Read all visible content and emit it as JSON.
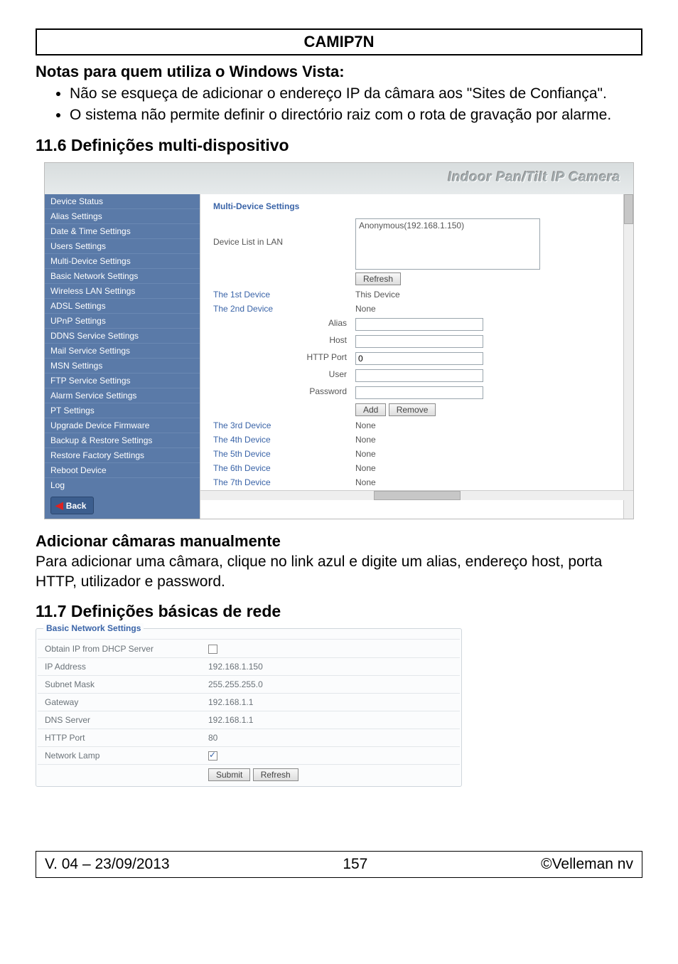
{
  "header": {
    "title": "CAMIP7N"
  },
  "notas": {
    "heading": "Notas para quem utiliza o Windows Vista:",
    "items": [
      "Não se esqueça de adicionar o endereço IP da câmara aos \"Sites de Confiança\".",
      "O sistema não permite definir o directório raiz com o rota de gravação por alarme."
    ]
  },
  "sec_multi": {
    "heading": "11.6   Definições multi-dispositivo",
    "brand": "Indoor Pan/Tilt IP Camera",
    "sidebar": [
      "Device Status",
      "Alias Settings",
      "Date & Time Settings",
      "Users Settings",
      "Multi-Device Settings",
      "Basic Network Settings",
      "Wireless LAN Settings",
      "ADSL Settings",
      "UPnP Settings",
      "DDNS Service Settings",
      "Mail Service Settings",
      "MSN Settings",
      "FTP Service Settings",
      "Alarm Service Settings",
      "PT Settings",
      "Upgrade Device Firmware",
      "Backup & Restore Settings",
      "Restore Factory Settings",
      "Reboot Device",
      "Log"
    ],
    "back": "Back",
    "panel": {
      "title": "Multi-Device Settings",
      "lan_label": "Device List in LAN",
      "lan_item": "Anonymous(192.168.1.150)",
      "refresh": "Refresh",
      "dev1_label": "The 1st Device",
      "dev1_value": "This Device",
      "dev2_label": "The 2nd Device",
      "dev2_value": "None",
      "alias_label": "Alias",
      "host_label": "Host",
      "httpport_label": "HTTP Port",
      "httpport_value": "0",
      "user_label": "User",
      "password_label": "Password",
      "add": "Add",
      "remove": "Remove",
      "dev3_label": "The 3rd Device",
      "dev3_value": "None",
      "dev4_label": "The 4th Device",
      "dev4_value": "None",
      "dev5_label": "The 5th Device",
      "dev5_value": "None",
      "dev6_label": "The 6th Device",
      "dev6_value": "None",
      "dev7_label": "The 7th Device",
      "dev7_value": "None"
    }
  },
  "manual": {
    "heading": "Adicionar câmaras manualmente",
    "text": "Para adicionar uma câmara, clique no link azul e digite um alias, endereço host, porta HTTP, utilizador e password."
  },
  "sec_basic": {
    "heading": "11.7   Definições básicas de rede",
    "legend": "Basic Network Settings",
    "rows": {
      "dhcp_label": "Obtain IP from DHCP Server",
      "ip_label": "IP Address",
      "ip_value": "192.168.1.150",
      "subnet_label": "Subnet Mask",
      "subnet_value": "255.255.255.0",
      "gw_label": "Gateway",
      "gw_value": "192.168.1.1",
      "dns_label": "DNS Server",
      "dns_value": "192.168.1.1",
      "http_label": "HTTP Port",
      "http_value": "80",
      "lamp_label": "Network Lamp"
    },
    "submit": "Submit",
    "refresh": "Refresh"
  },
  "footer": {
    "left": "V. 04 – 23/09/2013",
    "center": "157",
    "right": "©Velleman nv"
  }
}
